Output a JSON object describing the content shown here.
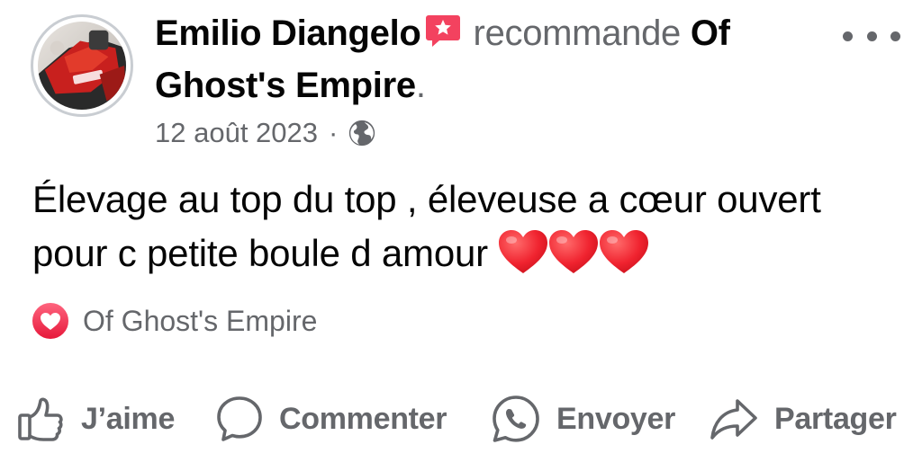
{
  "post": {
    "author": "Emilio Diangelo",
    "verb": "recommande",
    "page_name": "Of Ghost's Empire",
    "page_name_line1": "Of",
    "page_name_line2": "Ghost's Empire",
    "period": ".",
    "date": "12 août 2023",
    "separator": "·",
    "privacy_icon": "globe-icon",
    "text_line1": "Élevage au top du top , éleveuse a cœur ouvert",
    "text_line2": "pour c petite boule d amour",
    "emoji": "❤❤❤",
    "recommend_badge_icon": "recommend-star-icon"
  },
  "reactions": {
    "icon": "love-react-icon",
    "label": "Of Ghost's Empire"
  },
  "actions": {
    "like": "J’aime",
    "comment": "Commenter",
    "send": "Envoyer",
    "share": "Partager"
  },
  "colors": {
    "text_primary": "#050505",
    "text_secondary": "#65676b",
    "heart_red": "#f02849",
    "recommend_badge": "#f3425f"
  }
}
